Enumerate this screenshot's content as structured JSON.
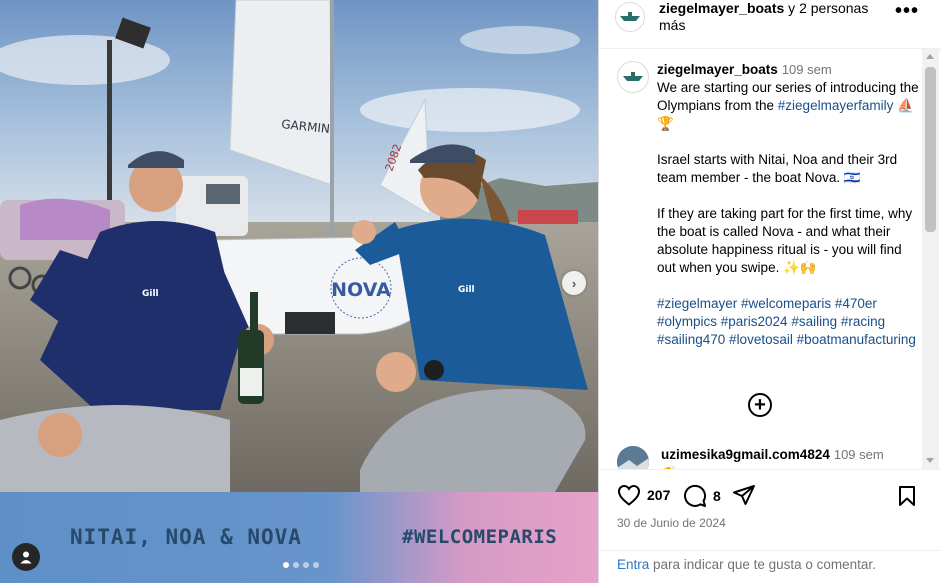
{
  "post": {
    "media": {
      "banner_left": "NITAI, NOA & NOVA",
      "banner_right": "#WELCOMEPARIS",
      "boat_name": "NOVA",
      "sail_text": "GARMIN",
      "sail_numbers": "2082",
      "shirt_logo": "Gill",
      "next_icon": "chevron-right-icon",
      "user_tag_icon": "person-icon",
      "carousel_dots": 4,
      "carousel_active": 1
    },
    "header": {
      "username": "ziegelmayer_boats",
      "suffix": " y 2 personas más",
      "more_icon": "more-horizontal-icon",
      "more_label": "•••"
    },
    "caption": {
      "username": "ziegelmayer_boats",
      "time": "109 sem",
      "line1": "We are starting our series of introducing the Olympians from the ",
      "line1_tag": "#ziegelmayerfamily",
      "line1_emoji": "⛵🏆",
      "para2": "Israel starts with Nitai, Noa and their 3rd team member - the boat Nova. 🇮🇱",
      "para3": "If they are taking part for the first time, why the boat is called Nova - and what their absolute happiness ritual is - you will find out when you swipe. ✨🙌",
      "hashtags": "#ziegelmayer #welcomeparis #470er #olympics #paris2024 #sailing #racing #sailing470 #lovetosail #boatmanufacturing"
    },
    "load_more": {
      "icon": "plus-circle-icon",
      "label": "+"
    },
    "comment": {
      "username": "uzimesika9gmail.com4824",
      "time": "109 sem",
      "text": "👏"
    },
    "actions": {
      "like_icon": "heart-icon",
      "likes": "207",
      "comment_icon": "comment-icon",
      "comments": "8",
      "share_icon": "send-icon",
      "save_icon": "bookmark-icon"
    },
    "date": "30 de Junio de 2024",
    "login_prompt": {
      "link": "Entra",
      "rest": " para indicar que te gusta o comentar."
    }
  },
  "colors": {
    "link": "#2b79c2",
    "banner_blue": "#5e8fc7",
    "banner_pink": "#e6a2c8",
    "banner_text": "#27496a"
  }
}
